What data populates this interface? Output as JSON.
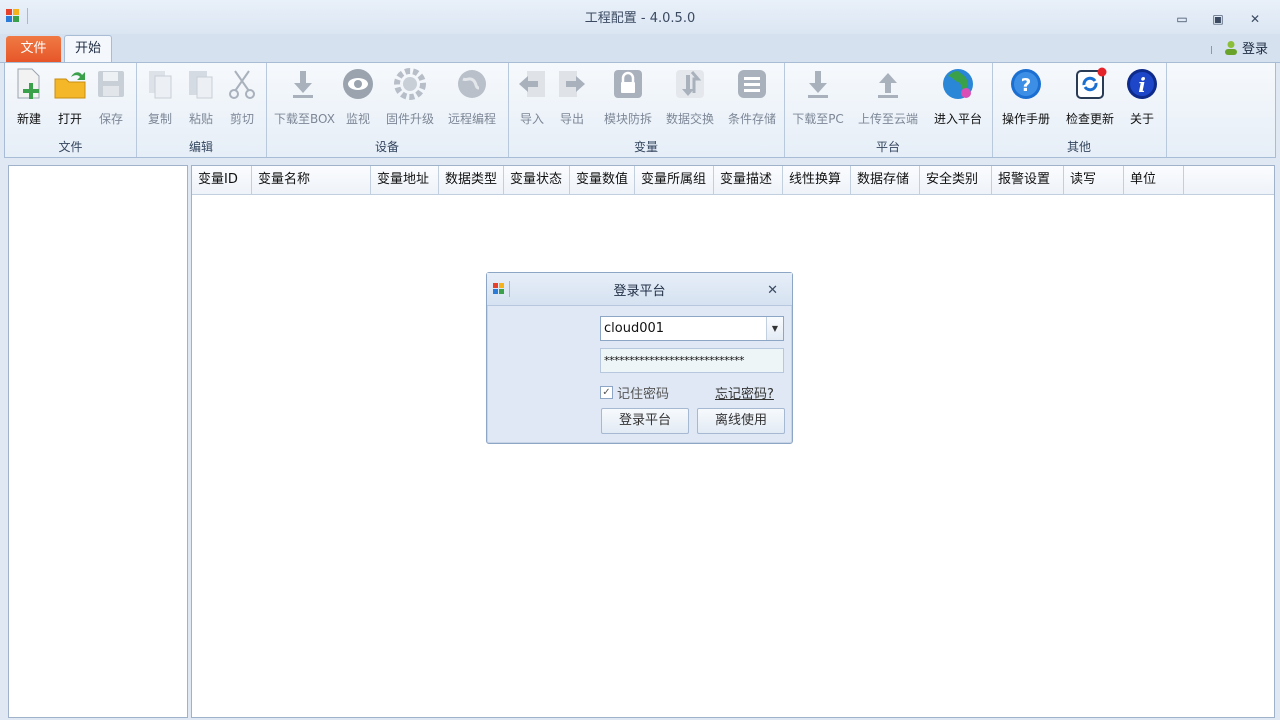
{
  "window": {
    "title": "工程配置 - 4.0.5.0",
    "controls": {
      "minimize": "▭",
      "restore": "▣",
      "close": "✕"
    }
  },
  "tabs": {
    "file": "文件",
    "start": "开始",
    "login": "登录"
  },
  "ribbon": {
    "groups": [
      {
        "label": "文件",
        "buttons": [
          "新建",
          "打开",
          "保存"
        ]
      },
      {
        "label": "编辑",
        "buttons": [
          "复制",
          "粘贴",
          "剪切"
        ]
      },
      {
        "label": "设备",
        "buttons": [
          "下载至BOX",
          "监视",
          "固件升级",
          "远程编程"
        ]
      },
      {
        "label": "变量",
        "buttons": [
          "导入",
          "导出",
          "模块防拆",
          "数据交换",
          "条件存储"
        ]
      },
      {
        "label": "平台",
        "buttons": [
          "下载至PC",
          "上传至云端",
          "进入平台"
        ]
      },
      {
        "label": "其他",
        "buttons": [
          "操作手册",
          "检查更新",
          "关于"
        ]
      }
    ]
  },
  "grid": {
    "columns": [
      "变量ID",
      "变量名称",
      "变量地址",
      "数据类型",
      "变量状态",
      "变量数值",
      "变量所属组",
      "变量描述",
      "线性换算",
      "数据存储",
      "安全类别",
      "报警设置",
      "读写",
      "单位"
    ]
  },
  "login_dialog": {
    "title": "登录平台",
    "username": "cloud001",
    "password_mask": "****************************",
    "remember_label": "记住密码",
    "remember_checked": "✓",
    "forgot_label": "忘记密码?",
    "login_button": "登录平台",
    "offline_button": "离线使用"
  },
  "icons": {
    "new": "new-file-icon",
    "open": "open-folder-icon",
    "save": "save-disk-icon",
    "copy": "copy-icon",
    "paste": "paste-icon",
    "cut": "scissors-icon",
    "download": "download-arrow-icon",
    "monitor": "eye-icon",
    "firmware": "gear-icon",
    "remote": "globe-icon",
    "import": "import-arrow-icon",
    "export": "export-arrow-icon",
    "tamper": "lock-icon",
    "exchange": "exchange-icon",
    "storage": "list-icon",
    "upload": "upload-arrow-icon",
    "platform": "earth-icon",
    "manual": "help-icon",
    "update": "refresh-icon",
    "about": "info-icon"
  },
  "colors": {
    "file_tab": "#e6562a",
    "accent_blue": "#1b6fd1"
  }
}
